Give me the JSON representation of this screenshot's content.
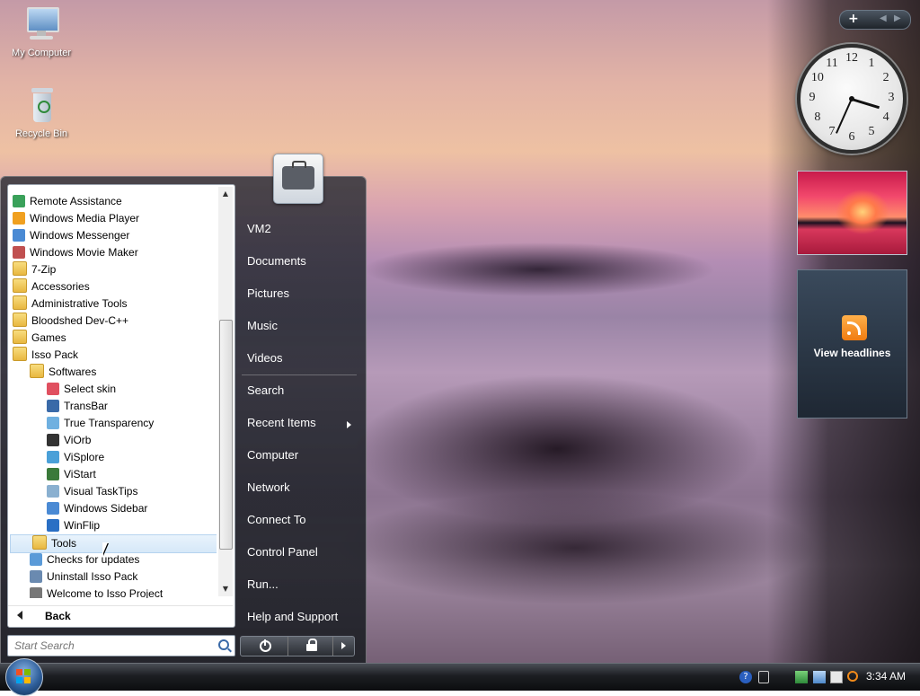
{
  "desktop": {
    "icons": [
      {
        "label": "My Computer",
        "icon": "my-computer-icon"
      },
      {
        "label": "Recycle Bin",
        "icon": "recycle-bin-icon"
      }
    ]
  },
  "start_menu": {
    "programs": [
      {
        "label": "Remote Assistance",
        "icon": "remote-assistance-icon",
        "indent": 0
      },
      {
        "label": "Windows Media Player",
        "icon": "media-player-icon",
        "indent": 0
      },
      {
        "label": "Windows Messenger",
        "icon": "messenger-icon",
        "indent": 0
      },
      {
        "label": "Windows Movie Maker",
        "icon": "movie-maker-icon",
        "indent": 0
      },
      {
        "label": "7-Zip",
        "icon": "folder-icon",
        "indent": 0
      },
      {
        "label": "Accessories",
        "icon": "folder-icon",
        "indent": 0
      },
      {
        "label": "Administrative Tools",
        "icon": "folder-icon",
        "indent": 0
      },
      {
        "label": "Bloodshed Dev-C++",
        "icon": "folder-icon",
        "indent": 0
      },
      {
        "label": "Games",
        "icon": "folder-icon",
        "indent": 0
      },
      {
        "label": "Isso Pack",
        "icon": "folder-icon",
        "indent": 0
      },
      {
        "label": "Softwares",
        "icon": "folder-icon",
        "indent": 1
      },
      {
        "label": "Select skin",
        "icon": "select-skin-icon",
        "indent": 2
      },
      {
        "label": "TransBar",
        "icon": "transbar-icon",
        "indent": 2
      },
      {
        "label": "True Transparency",
        "icon": "true-transparency-icon",
        "indent": 2
      },
      {
        "label": "ViOrb",
        "icon": "viorb-icon",
        "indent": 2
      },
      {
        "label": "ViSplore",
        "icon": "visplore-icon",
        "indent": 2
      },
      {
        "label": "ViStart",
        "icon": "vistart-icon",
        "indent": 2
      },
      {
        "label": "Visual TaskTips",
        "icon": "visual-tasktips-icon",
        "indent": 2
      },
      {
        "label": "Windows Sidebar",
        "icon": "windows-sidebar-icon",
        "indent": 2
      },
      {
        "label": "WinFlip",
        "icon": "winflip-icon",
        "indent": 2
      },
      {
        "label": "Tools",
        "icon": "folder-icon",
        "indent": 1,
        "selected": true
      },
      {
        "label": "Checks for updates",
        "icon": "update-icon",
        "indent": 1
      },
      {
        "label": "Uninstall Isso Pack",
        "icon": "uninstall-icon",
        "indent": 1
      },
      {
        "label": "Welcome to Isso Project",
        "icon": "welcome-icon",
        "indent": 1
      }
    ],
    "back_label": "Back",
    "search_placeholder": "Start Search",
    "right_items": [
      "VM2",
      "Documents",
      "Pictures",
      "Music",
      "Videos",
      "Search",
      "Recent Items",
      "Computer",
      "Network",
      "Connect To",
      "Control Panel",
      "Run...",
      "Help and Support"
    ]
  },
  "gadgets": {
    "clock": {
      "hours": 3,
      "minutes": 34,
      "numbers": [
        "12",
        "1",
        "2",
        "3",
        "4",
        "5",
        "6",
        "7",
        "8",
        "9",
        "10",
        "11"
      ]
    },
    "news": {
      "label": "View headlines"
    }
  },
  "taskbar": {
    "time": "3:34 AM"
  },
  "colors": {
    "accent": "#2e5e9a",
    "rss_orange": "#f07b10",
    "selected_row": "#d6e8f8"
  }
}
